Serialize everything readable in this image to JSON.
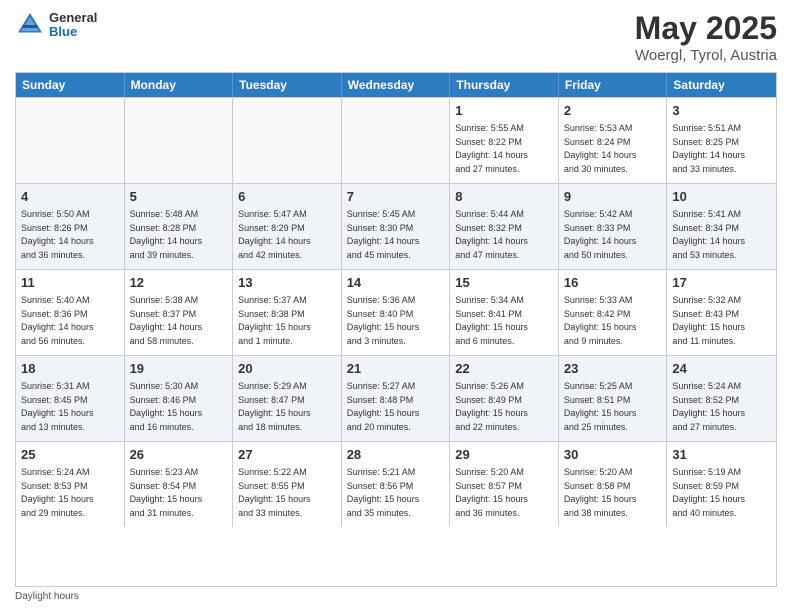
{
  "header": {
    "logo_general": "General",
    "logo_blue": "Blue",
    "title": "May 2025",
    "location": "Woergl, Tyrol, Austria"
  },
  "days_of_week": [
    "Sunday",
    "Monday",
    "Tuesday",
    "Wednesday",
    "Thursday",
    "Friday",
    "Saturday"
  ],
  "weeks": [
    [
      {
        "day": "",
        "info": "",
        "empty": true
      },
      {
        "day": "",
        "info": "",
        "empty": true
      },
      {
        "day": "",
        "info": "",
        "empty": true
      },
      {
        "day": "",
        "info": "",
        "empty": true
      },
      {
        "day": "1",
        "info": "Sunrise: 5:55 AM\nSunset: 8:22 PM\nDaylight: 14 hours\nand 27 minutes."
      },
      {
        "day": "2",
        "info": "Sunrise: 5:53 AM\nSunset: 8:24 PM\nDaylight: 14 hours\nand 30 minutes."
      },
      {
        "day": "3",
        "info": "Sunrise: 5:51 AM\nSunset: 8:25 PM\nDaylight: 14 hours\nand 33 minutes."
      }
    ],
    [
      {
        "day": "4",
        "info": "Sunrise: 5:50 AM\nSunset: 8:26 PM\nDaylight: 14 hours\nand 36 minutes."
      },
      {
        "day": "5",
        "info": "Sunrise: 5:48 AM\nSunset: 8:28 PM\nDaylight: 14 hours\nand 39 minutes."
      },
      {
        "day": "6",
        "info": "Sunrise: 5:47 AM\nSunset: 8:29 PM\nDaylight: 14 hours\nand 42 minutes."
      },
      {
        "day": "7",
        "info": "Sunrise: 5:45 AM\nSunset: 8:30 PM\nDaylight: 14 hours\nand 45 minutes."
      },
      {
        "day": "8",
        "info": "Sunrise: 5:44 AM\nSunset: 8:32 PM\nDaylight: 14 hours\nand 47 minutes."
      },
      {
        "day": "9",
        "info": "Sunrise: 5:42 AM\nSunset: 8:33 PM\nDaylight: 14 hours\nand 50 minutes."
      },
      {
        "day": "10",
        "info": "Sunrise: 5:41 AM\nSunset: 8:34 PM\nDaylight: 14 hours\nand 53 minutes."
      }
    ],
    [
      {
        "day": "11",
        "info": "Sunrise: 5:40 AM\nSunset: 8:36 PM\nDaylight: 14 hours\nand 56 minutes."
      },
      {
        "day": "12",
        "info": "Sunrise: 5:38 AM\nSunset: 8:37 PM\nDaylight: 14 hours\nand 58 minutes."
      },
      {
        "day": "13",
        "info": "Sunrise: 5:37 AM\nSunset: 8:38 PM\nDaylight: 15 hours\nand 1 minute."
      },
      {
        "day": "14",
        "info": "Sunrise: 5:36 AM\nSunset: 8:40 PM\nDaylight: 15 hours\nand 3 minutes."
      },
      {
        "day": "15",
        "info": "Sunrise: 5:34 AM\nSunset: 8:41 PM\nDaylight: 15 hours\nand 6 minutes."
      },
      {
        "day": "16",
        "info": "Sunrise: 5:33 AM\nSunset: 8:42 PM\nDaylight: 15 hours\nand 9 minutes."
      },
      {
        "day": "17",
        "info": "Sunrise: 5:32 AM\nSunset: 8:43 PM\nDaylight: 15 hours\nand 11 minutes."
      }
    ],
    [
      {
        "day": "18",
        "info": "Sunrise: 5:31 AM\nSunset: 8:45 PM\nDaylight: 15 hours\nand 13 minutes."
      },
      {
        "day": "19",
        "info": "Sunrise: 5:30 AM\nSunset: 8:46 PM\nDaylight: 15 hours\nand 16 minutes."
      },
      {
        "day": "20",
        "info": "Sunrise: 5:29 AM\nSunset: 8:47 PM\nDaylight: 15 hours\nand 18 minutes."
      },
      {
        "day": "21",
        "info": "Sunrise: 5:27 AM\nSunset: 8:48 PM\nDaylight: 15 hours\nand 20 minutes."
      },
      {
        "day": "22",
        "info": "Sunrise: 5:26 AM\nSunset: 8:49 PM\nDaylight: 15 hours\nand 22 minutes."
      },
      {
        "day": "23",
        "info": "Sunrise: 5:25 AM\nSunset: 8:51 PM\nDaylight: 15 hours\nand 25 minutes."
      },
      {
        "day": "24",
        "info": "Sunrise: 5:24 AM\nSunset: 8:52 PM\nDaylight: 15 hours\nand 27 minutes."
      }
    ],
    [
      {
        "day": "25",
        "info": "Sunrise: 5:24 AM\nSunset: 8:53 PM\nDaylight: 15 hours\nand 29 minutes."
      },
      {
        "day": "26",
        "info": "Sunrise: 5:23 AM\nSunset: 8:54 PM\nDaylight: 15 hours\nand 31 minutes."
      },
      {
        "day": "27",
        "info": "Sunrise: 5:22 AM\nSunset: 8:55 PM\nDaylight: 15 hours\nand 33 minutes."
      },
      {
        "day": "28",
        "info": "Sunrise: 5:21 AM\nSunset: 8:56 PM\nDaylight: 15 hours\nand 35 minutes."
      },
      {
        "day": "29",
        "info": "Sunrise: 5:20 AM\nSunset: 8:57 PM\nDaylight: 15 hours\nand 36 minutes."
      },
      {
        "day": "30",
        "info": "Sunrise: 5:20 AM\nSunset: 8:58 PM\nDaylight: 15 hours\nand 38 minutes."
      },
      {
        "day": "31",
        "info": "Sunrise: 5:19 AM\nSunset: 8:59 PM\nDaylight: 15 hours\nand 40 minutes."
      }
    ]
  ],
  "footer": "Daylight hours"
}
